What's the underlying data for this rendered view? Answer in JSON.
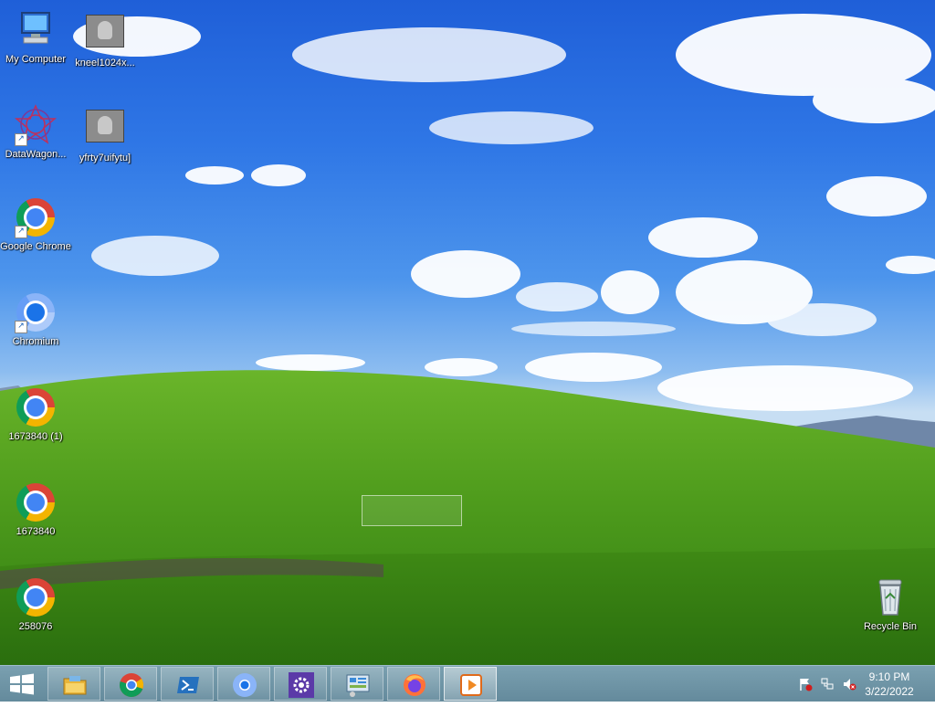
{
  "desktop": {
    "icons": [
      {
        "label": "My Computer",
        "icon": "computer-icon"
      },
      {
        "label": "kneel1024x...",
        "icon": "image-thumbnail-icon"
      },
      {
        "label": "DataWagon...",
        "icon": "datawagon-icon"
      },
      {
        "label": "yfrty7uifytu]",
        "icon": "image-thumbnail-icon"
      },
      {
        "label": "Google Chrome",
        "icon": "chrome-icon"
      },
      {
        "label": "Chromium",
        "icon": "chromium-icon"
      },
      {
        "label": "1673840 (1)",
        "icon": "chrome-icon"
      },
      {
        "label": "1673840",
        "icon": "chrome-icon"
      },
      {
        "label": "258076",
        "icon": "chrome-icon"
      },
      {
        "label": "Recycle Bin",
        "icon": "recycle-bin-icon"
      }
    ]
  },
  "taskbar": {
    "start_icon": "windows-start-icon",
    "pinned": [
      {
        "name": "File Explorer",
        "icon": "file-explorer-icon"
      },
      {
        "name": "Google Chrome",
        "icon": "chrome-icon"
      },
      {
        "name": "PowerShell",
        "icon": "powershell-icon"
      },
      {
        "name": "Chromium",
        "icon": "chromium-icon"
      },
      {
        "name": "Settings",
        "icon": "settings-gear-icon"
      },
      {
        "name": "Control Panel",
        "icon": "control-panel-icon"
      },
      {
        "name": "Firefox",
        "icon": "firefox-icon"
      },
      {
        "name": "Media Player",
        "icon": "media-player-icon",
        "active": true
      }
    ],
    "tray": {
      "icons": [
        "action-center-flag-icon",
        "network-icon",
        "volume-muted-icon"
      ],
      "time": "9:10 PM",
      "date": "3/22/2022"
    }
  },
  "colors": {
    "taskbar": "#6e94a6",
    "sky": "#2f77e6",
    "grass": "#4f9a1d"
  }
}
